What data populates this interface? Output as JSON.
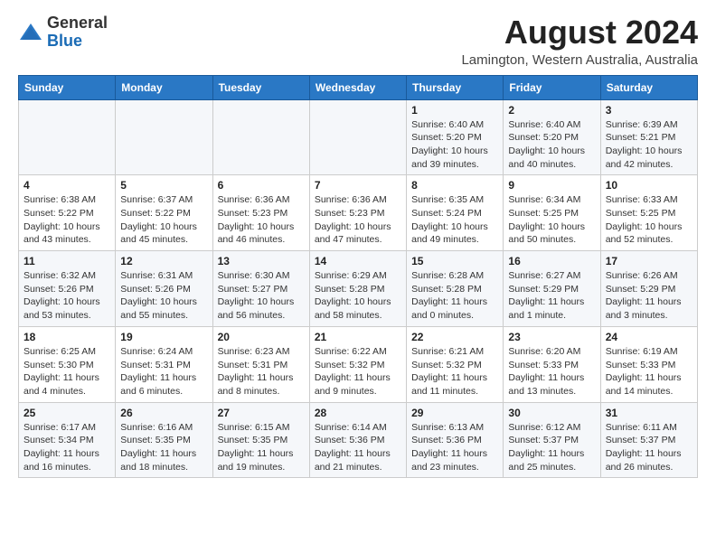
{
  "header": {
    "logo_line1": "General",
    "logo_line2": "Blue",
    "month_year": "August 2024",
    "location": "Lamington, Western Australia, Australia"
  },
  "calendar": {
    "days_of_week": [
      "Sunday",
      "Monday",
      "Tuesday",
      "Wednesday",
      "Thursday",
      "Friday",
      "Saturday"
    ],
    "weeks": [
      [
        {
          "day": "",
          "info": ""
        },
        {
          "day": "",
          "info": ""
        },
        {
          "day": "",
          "info": ""
        },
        {
          "day": "",
          "info": ""
        },
        {
          "day": "1",
          "info": "Sunrise: 6:40 AM\nSunset: 5:20 PM\nDaylight: 10 hours and 39 minutes."
        },
        {
          "day": "2",
          "info": "Sunrise: 6:40 AM\nSunset: 5:20 PM\nDaylight: 10 hours and 40 minutes."
        },
        {
          "day": "3",
          "info": "Sunrise: 6:39 AM\nSunset: 5:21 PM\nDaylight: 10 hours and 42 minutes."
        }
      ],
      [
        {
          "day": "4",
          "info": "Sunrise: 6:38 AM\nSunset: 5:22 PM\nDaylight: 10 hours and 43 minutes."
        },
        {
          "day": "5",
          "info": "Sunrise: 6:37 AM\nSunset: 5:22 PM\nDaylight: 10 hours and 45 minutes."
        },
        {
          "day": "6",
          "info": "Sunrise: 6:36 AM\nSunset: 5:23 PM\nDaylight: 10 hours and 46 minutes."
        },
        {
          "day": "7",
          "info": "Sunrise: 6:36 AM\nSunset: 5:23 PM\nDaylight: 10 hours and 47 minutes."
        },
        {
          "day": "8",
          "info": "Sunrise: 6:35 AM\nSunset: 5:24 PM\nDaylight: 10 hours and 49 minutes."
        },
        {
          "day": "9",
          "info": "Sunrise: 6:34 AM\nSunset: 5:25 PM\nDaylight: 10 hours and 50 minutes."
        },
        {
          "day": "10",
          "info": "Sunrise: 6:33 AM\nSunset: 5:25 PM\nDaylight: 10 hours and 52 minutes."
        }
      ],
      [
        {
          "day": "11",
          "info": "Sunrise: 6:32 AM\nSunset: 5:26 PM\nDaylight: 10 hours and 53 minutes."
        },
        {
          "day": "12",
          "info": "Sunrise: 6:31 AM\nSunset: 5:26 PM\nDaylight: 10 hours and 55 minutes."
        },
        {
          "day": "13",
          "info": "Sunrise: 6:30 AM\nSunset: 5:27 PM\nDaylight: 10 hours and 56 minutes."
        },
        {
          "day": "14",
          "info": "Sunrise: 6:29 AM\nSunset: 5:28 PM\nDaylight: 10 hours and 58 minutes."
        },
        {
          "day": "15",
          "info": "Sunrise: 6:28 AM\nSunset: 5:28 PM\nDaylight: 11 hours and 0 minutes."
        },
        {
          "day": "16",
          "info": "Sunrise: 6:27 AM\nSunset: 5:29 PM\nDaylight: 11 hours and 1 minute."
        },
        {
          "day": "17",
          "info": "Sunrise: 6:26 AM\nSunset: 5:29 PM\nDaylight: 11 hours and 3 minutes."
        }
      ],
      [
        {
          "day": "18",
          "info": "Sunrise: 6:25 AM\nSunset: 5:30 PM\nDaylight: 11 hours and 4 minutes."
        },
        {
          "day": "19",
          "info": "Sunrise: 6:24 AM\nSunset: 5:31 PM\nDaylight: 11 hours and 6 minutes."
        },
        {
          "day": "20",
          "info": "Sunrise: 6:23 AM\nSunset: 5:31 PM\nDaylight: 11 hours and 8 minutes."
        },
        {
          "day": "21",
          "info": "Sunrise: 6:22 AM\nSunset: 5:32 PM\nDaylight: 11 hours and 9 minutes."
        },
        {
          "day": "22",
          "info": "Sunrise: 6:21 AM\nSunset: 5:32 PM\nDaylight: 11 hours and 11 minutes."
        },
        {
          "day": "23",
          "info": "Sunrise: 6:20 AM\nSunset: 5:33 PM\nDaylight: 11 hours and 13 minutes."
        },
        {
          "day": "24",
          "info": "Sunrise: 6:19 AM\nSunset: 5:33 PM\nDaylight: 11 hours and 14 minutes."
        }
      ],
      [
        {
          "day": "25",
          "info": "Sunrise: 6:17 AM\nSunset: 5:34 PM\nDaylight: 11 hours and 16 minutes."
        },
        {
          "day": "26",
          "info": "Sunrise: 6:16 AM\nSunset: 5:35 PM\nDaylight: 11 hours and 18 minutes."
        },
        {
          "day": "27",
          "info": "Sunrise: 6:15 AM\nSunset: 5:35 PM\nDaylight: 11 hours and 19 minutes."
        },
        {
          "day": "28",
          "info": "Sunrise: 6:14 AM\nSunset: 5:36 PM\nDaylight: 11 hours and 21 minutes."
        },
        {
          "day": "29",
          "info": "Sunrise: 6:13 AM\nSunset: 5:36 PM\nDaylight: 11 hours and 23 minutes."
        },
        {
          "day": "30",
          "info": "Sunrise: 6:12 AM\nSunset: 5:37 PM\nDaylight: 11 hours and 25 minutes."
        },
        {
          "day": "31",
          "info": "Sunrise: 6:11 AM\nSunset: 5:37 PM\nDaylight: 11 hours and 26 minutes."
        }
      ]
    ]
  }
}
